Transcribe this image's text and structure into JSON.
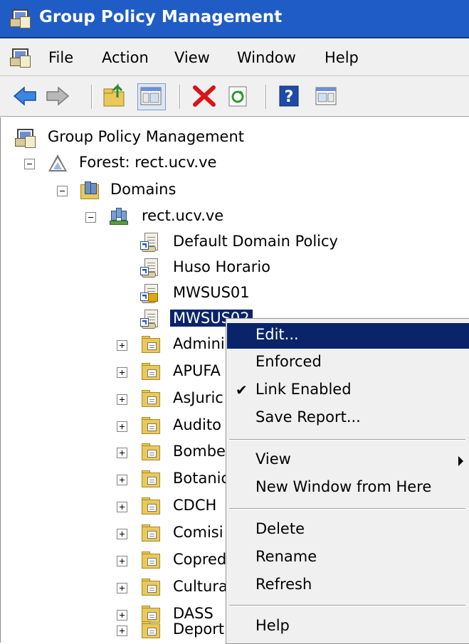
{
  "window": {
    "title": "Group Policy Management"
  },
  "menu": {
    "items": [
      "File",
      "Action",
      "View",
      "Window",
      "Help"
    ]
  },
  "toolbar": {
    "buttons": [
      "back-icon",
      "forward-icon",
      "up-folder-icon",
      "show-hide-tree-icon",
      "delete-icon",
      "refresh-icon",
      "help-icon",
      "show-action-pane-icon"
    ]
  },
  "tree": {
    "root": "Group Policy Management",
    "forest": "Forest: rect.ucv.ve",
    "domains": "Domains",
    "domain": "rect.ucv.ve",
    "gpos": [
      "Default Domain Policy",
      "Huso Horario",
      "MWSUS01",
      "MWSUS02"
    ],
    "ous": [
      "Admini",
      "APUFA",
      "AsJuric",
      "Audito",
      "Bombe",
      "Botanic",
      "CDCH",
      "Comisi",
      "Copred",
      "Cultura",
      "DASS",
      "Deport"
    ]
  },
  "context_menu": {
    "edit": "Edit...",
    "enforced": "Enforced",
    "link_enabled": "Link Enabled",
    "link_enabled_check": "✔",
    "save_report": "Save Report...",
    "view": "View",
    "new_window": "New Window from Here",
    "delete": "Delete",
    "rename": "Rename",
    "refresh": "Refresh",
    "help": "Help"
  },
  "colors": {
    "titlebar": "#1f5cc6",
    "selection": "#0a246a",
    "menubar": "#f0f0f0"
  }
}
